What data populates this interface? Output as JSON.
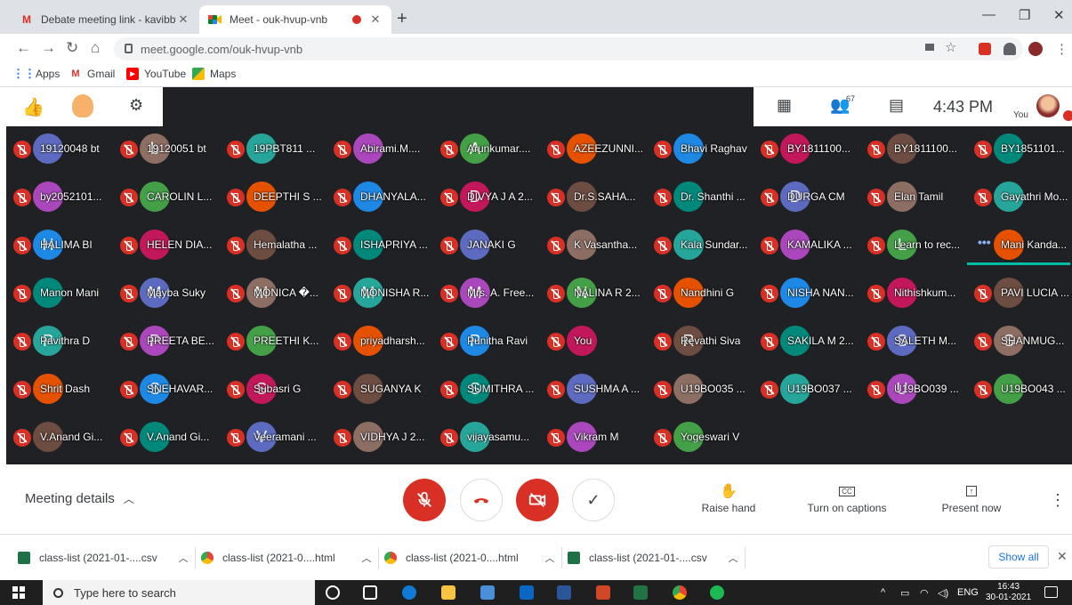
{
  "tabs": [
    {
      "title": "Debate meeting link - kavibbt@g",
      "icon": "gmail-icon"
    },
    {
      "title": "Meet - ouk-hvup-vnb",
      "icon": "meet-icon"
    }
  ],
  "address": {
    "url": "meet.google.com/ouk-hvup-vnb"
  },
  "bookmarks": {
    "apps": "Apps",
    "gmail": "Gmail",
    "youtube": "YouTube",
    "maps": "Maps"
  },
  "meet_header": {
    "participant_count": "67",
    "time": "4:43 PM",
    "self_label": "You"
  },
  "participants": [
    [
      "19120048 bt",
      "19120051 bt",
      "19PBT811 ...",
      "Abirami.M....",
      "Arunkumar....",
      "AZEEZUNNI...",
      "Bhavi Raghav",
      "BY1811100...",
      "BY1811100...",
      "BY1851101..."
    ],
    [
      "by2052101...",
      "CAROLIN L...",
      "DEEPTHI S ...",
      "DHANYALA...",
      "DIVYA J A 2...",
      "Dr.S.SAHA...",
      "Dr. Shanthi ...",
      "DURGA CM",
      "Elan Tamil",
      "Gayathri Mo..."
    ],
    [
      "HALIMA BI",
      "HELEN DIA...",
      "Hemalatha ...",
      "ISHAPRIYA ...",
      "JANAKI G",
      "K Vasantha...",
      "Kala Sundar...",
      "KAMALIKA ...",
      "Learn to rec...",
      "Mani Kanda..."
    ],
    [
      "Manon Mani",
      "Mayba Suky",
      "MONICA �...",
      "MONISHA R...",
      "Mrs. A. Free...",
      "NALINA R 2...",
      "Nandhini G",
      "NISHA NAN...",
      "Nithishkum...",
      "PAVI LUCIA ..."
    ],
    [
      "Pavithra D",
      "PREETA BE...",
      "PREETHI K...",
      "priyadharsh...",
      "Punitha Ravi",
      "You",
      "Revathi Siva",
      "SAKILA M 2...",
      "SALETH M...",
      "SHANMUG..."
    ],
    [
      "Shrit Dash",
      "SNEHAVAR...",
      "Subasri G",
      "SUGANYA K",
      "SUMITHRA ...",
      "SUSHMA A ...",
      "U19BO035 ...",
      "U19BO037 ...",
      "U19BO039 ...",
      "U19BO043 ..."
    ],
    [
      "V.Anand Gi...",
      "V.Anand Gi...",
      "Veeramani ...",
      "VIDHYA J 2...",
      "vijayasamu...",
      "Vikram M",
      "Yogeswari V"
    ]
  ],
  "initials": [
    [
      "",
      "b",
      "",
      "",
      "A",
      "",
      "",
      "",
      "",
      ""
    ],
    [
      "",
      "",
      "",
      "",
      "D",
      "",
      "",
      "D",
      "",
      ""
    ],
    [
      "H",
      "",
      "",
      "",
      "",
      "",
      "",
      "",
      "L",
      ""
    ],
    [
      "",
      "M",
      "M",
      "M",
      "M",
      "N",
      "",
      "",
      "",
      ""
    ],
    [
      "P",
      "P",
      "",
      "",
      "P",
      "",
      "R",
      "",
      "S",
      "S"
    ],
    [
      "",
      "S",
      "S",
      "",
      "S",
      "",
      "",
      "",
      "U",
      ""
    ],
    [
      "",
      "",
      "V",
      "",
      "",
      "",
      ""
    ]
  ],
  "controls": {
    "meeting_details": "Meeting details",
    "raise_hand": "Raise hand",
    "captions": "Turn on captions",
    "present": "Present now"
  },
  "downloads": [
    {
      "name": "class-list (2021-01-....csv",
      "icon": "csv-icon"
    },
    {
      "name": "class-list (2021-0....html",
      "icon": "chrome-icon"
    },
    {
      "name": "class-list (2021-0....html",
      "icon": "chrome-icon"
    },
    {
      "name": "class-list (2021-01-....csv",
      "icon": "csv-icon"
    }
  ],
  "download_show_all": "Show all",
  "taskbar": {
    "search_placeholder": "Type here to search",
    "lang": "ENG",
    "time": "16:43",
    "date": "30-01-2021"
  },
  "colors": {
    "meet_bg": "#202124",
    "mute_red": "#d93025",
    "accent_teal": "#00bfa5",
    "link_blue": "#1a73e8"
  }
}
